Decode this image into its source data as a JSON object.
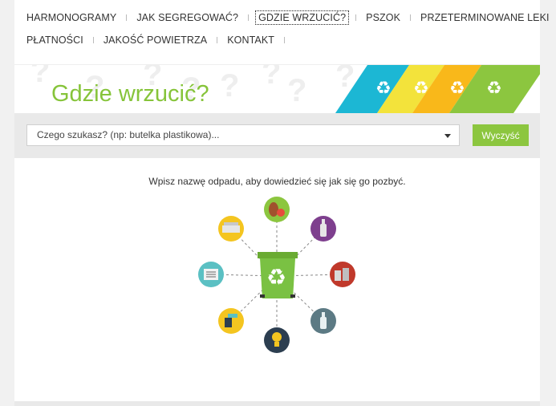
{
  "nav": {
    "row1": [
      {
        "label": "HARMONOGRAMY",
        "active": false
      },
      {
        "label": "JAK SEGREGOWAĆ?",
        "active": false
      },
      {
        "label": "GDZIE WRZUCIĆ?",
        "active": true
      },
      {
        "label": "PSZOK",
        "active": false
      },
      {
        "label": "PRZETERMINOWANE LEKI",
        "active": false
      }
    ],
    "row2": [
      {
        "label": "PŁATNOŚCI",
        "active": false
      },
      {
        "label": "JAKOŚĆ POWIETRZA",
        "active": false
      },
      {
        "label": "KONTAKT",
        "active": false
      }
    ]
  },
  "banner": {
    "title": "Gdzie wrzucić?",
    "stripe_colors": [
      "#1cb7d4",
      "#f3e33b",
      "#f9b81a",
      "#8cc63f"
    ]
  },
  "search": {
    "placeholder": "Czego szukasz? (np: butelka plastikowa)...",
    "clear_label": "Wyczyść"
  },
  "main": {
    "hint": "Wpisz nazwę odpadu, aby dowiedzieć się jak się go pozbyć.",
    "bin_color": "#7ac143",
    "categories": [
      {
        "name": "bio-waste-icon",
        "color": "#8cc63f"
      },
      {
        "name": "glass-bottle-icon",
        "color": "#7e3f8e"
      },
      {
        "name": "metal-cans-icon",
        "color": "#c0392b"
      },
      {
        "name": "plastic-bottle-icon",
        "color": "#5c7a84"
      },
      {
        "name": "light-bulb-icon",
        "color": "#2c3e50"
      },
      {
        "name": "electronics-icon",
        "color": "#f4c520"
      },
      {
        "name": "newspaper-icon",
        "color": "#5bc0c3"
      },
      {
        "name": "bulky-waste-icon",
        "color": "#f4c520"
      }
    ]
  }
}
